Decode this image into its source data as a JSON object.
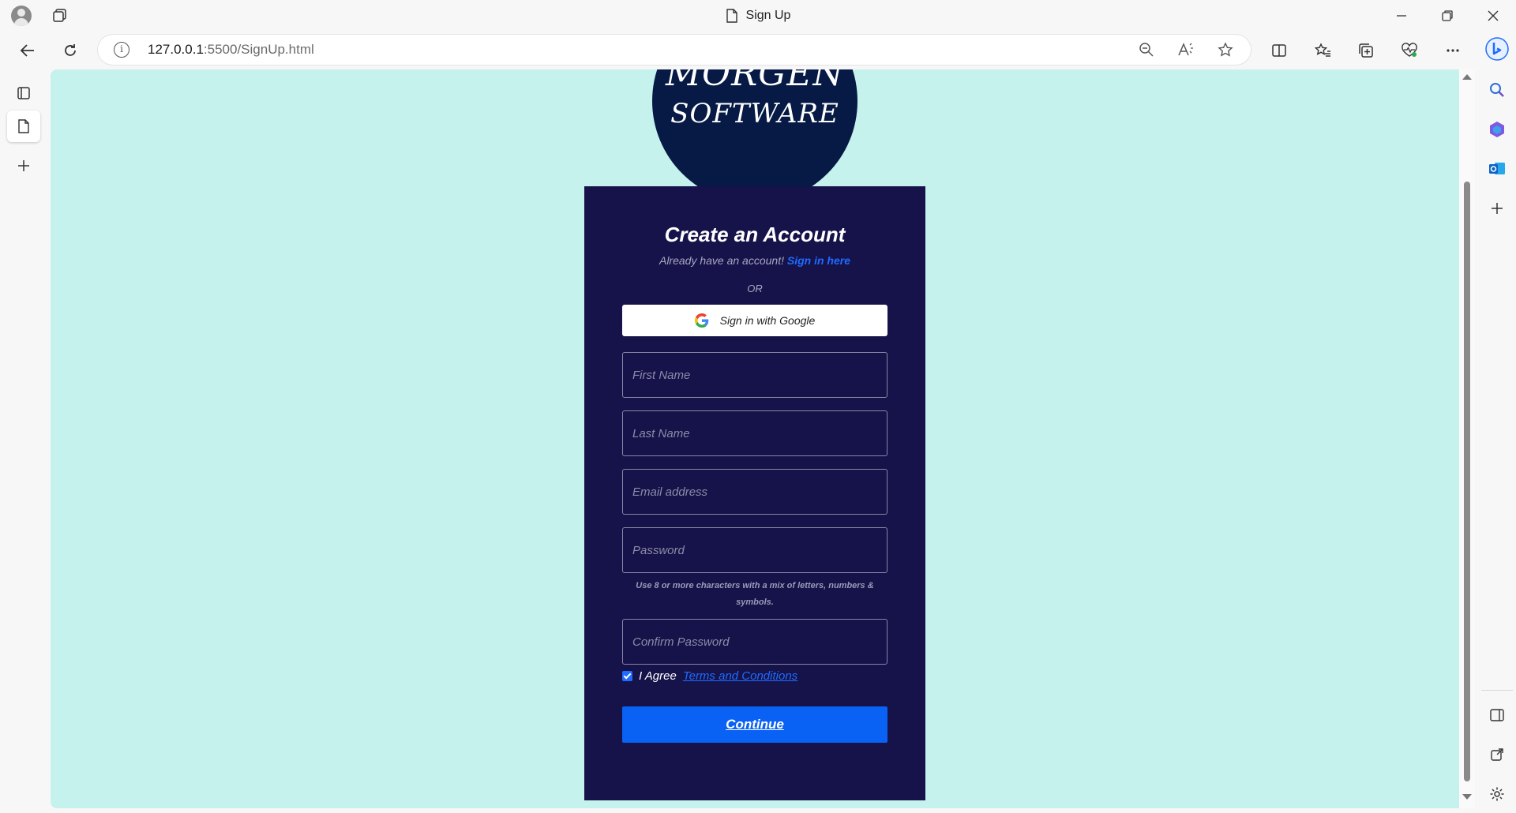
{
  "browser": {
    "tab_title": "Sign Up",
    "url_host": "127.0.0.1",
    "url_path": ":5500/SignUp.html"
  },
  "logo": {
    "line1": "MORGEN",
    "line2": "SOFTWARE"
  },
  "signup": {
    "title": "Create an Account",
    "have_account_text": "Already have an account!",
    "sign_in_link": "Sign in here",
    "or_text": "OR",
    "google_button": "Sign in with Google",
    "fields": {
      "first_name_placeholder": "First Name",
      "last_name_placeholder": "Last Name",
      "email_placeholder": "Email address",
      "password_placeholder": "Password",
      "confirm_password_placeholder": "Confirm Password"
    },
    "password_hint": "Use 8 or more characters with a mix of letters, numbers & symbols.",
    "agree_text": "I Agree",
    "terms_link": "Terms and Conditions",
    "terms_checked": true,
    "continue_button": "Continue"
  },
  "colors": {
    "page_bg": "#c6f2ee",
    "card_bg": "#16124a",
    "logo_bg": "#061a45",
    "accent": "#0a62f5"
  }
}
